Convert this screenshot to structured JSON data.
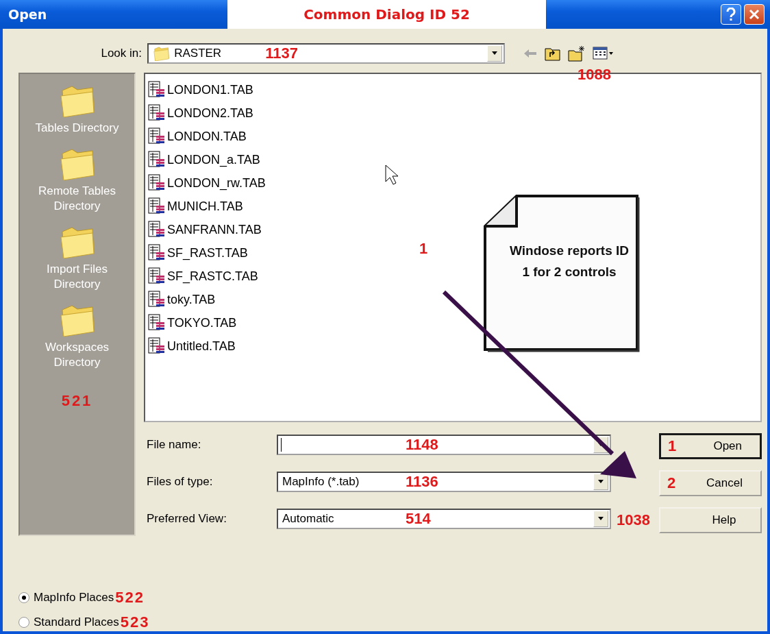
{
  "window": {
    "title": "Open",
    "annotation": "Common Dialog ID 52"
  },
  "look_in": {
    "label": "Look in:",
    "value": "RASTER",
    "annotation": "1137",
    "toolbar_annotation": "1088"
  },
  "places": {
    "annotation": "521",
    "items": [
      {
        "label": "Tables Directory"
      },
      {
        "label": "Remote Tables Directory"
      },
      {
        "label": "Import Files Directory"
      },
      {
        "label": "Workspaces Directory"
      }
    ]
  },
  "files": [
    "LONDON1.TAB",
    "LONDON2.TAB",
    "LONDON.TAB",
    "LONDON_a.TAB",
    "LONDON_rw.TAB",
    "MUNICH.TAB",
    "SANFRANN.TAB",
    "SF_RAST.TAB",
    "SF_RASTC.TAB",
    "toky.TAB",
    "TOKYO.TAB",
    "Untitled.TAB"
  ],
  "callout": {
    "text": "Windose reports ID 1 for 2 controls",
    "annotation": "1"
  },
  "fields": [
    {
      "label": "File name:",
      "annotation": "1148"
    },
    {
      "label": "Files of type:",
      "value": "MapInfo (*.tab)",
      "annotation": "1136"
    },
    {
      "label": "Preferred View:",
      "value": "Automatic",
      "annotation": "514"
    }
  ],
  "buttons": [
    {
      "label": "Open",
      "annotation": "1",
      "default": true
    },
    {
      "label": "Cancel",
      "annotation": "2",
      "default": false
    },
    {
      "label": "Help",
      "annotation": "1038",
      "default": false
    }
  ],
  "radios": [
    {
      "label": "MapInfo Places",
      "annotation": "522",
      "selected": true
    },
    {
      "label": "Standard Places",
      "annotation": "523",
      "selected": false
    }
  ]
}
